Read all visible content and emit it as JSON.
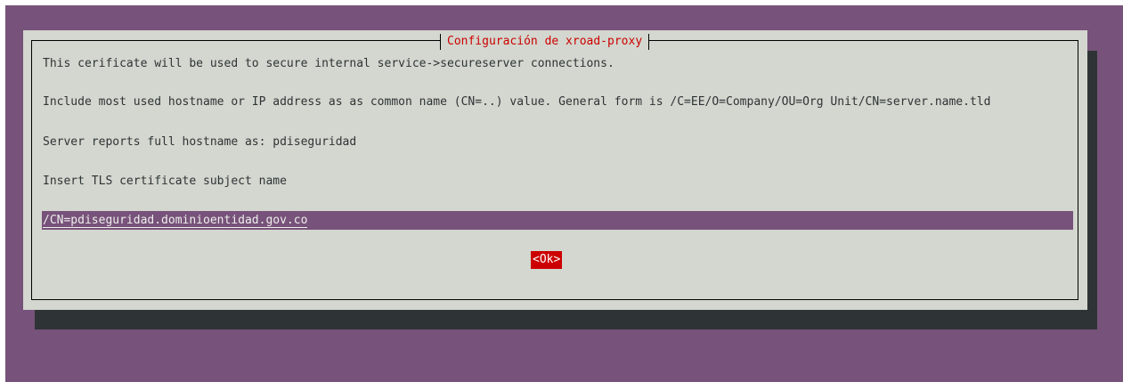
{
  "dialog": {
    "title": "Configuración de xroad-proxy",
    "lines": [
      "This cerificate will be used to secure internal service->secureserver connections.",
      "Include most used hostname or IP address as as common name (CN=..) value. General form is /C=EE/O=Company/OU=Org Unit/CN=server.name.tld",
      "Server reports full hostname as: pdiseguridad",
      "Insert TLS certificate subject name"
    ],
    "input_value": "/CN=pdiseguridad.dominioentidad.gov.co",
    "ok_label": "<Ok>"
  },
  "colors": {
    "terminal_background": "#77527a",
    "dialog_background": "#d3d7cf",
    "title_text": "#cc0000",
    "button_selected": "#cc0000"
  }
}
